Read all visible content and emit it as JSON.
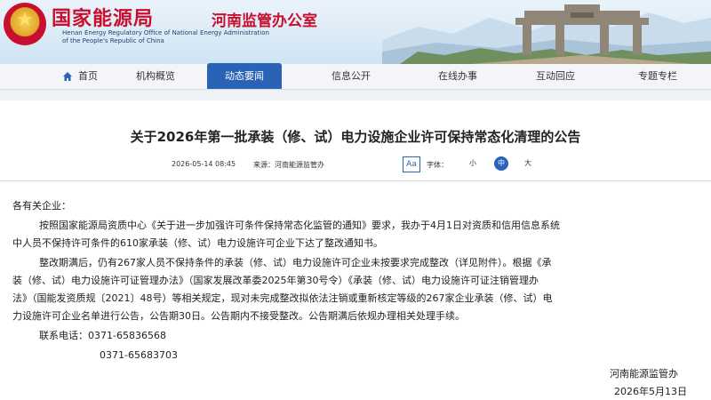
{
  "header": {
    "org_name_cn": "国家能源局",
    "office_name": "河南监管办公室",
    "org_name_en_line1": "Henan Energy Regulatory Office of National Energy Administration",
    "org_name_en_line2": "of the People's Republic of China"
  },
  "nav": {
    "items": [
      {
        "label": "首页",
        "icon": "home-icon",
        "active": false
      },
      {
        "label": "机构概览",
        "active": false
      },
      {
        "label": "动态要闻",
        "active": true
      },
      {
        "label": "信息公开",
        "active": false
      },
      {
        "label": "在线办事",
        "active": false
      },
      {
        "label": "互动回应",
        "active": false
      },
      {
        "label": "专题专栏",
        "active": false
      }
    ],
    "active_color": "#2a62b6"
  },
  "article": {
    "title": "关于2026年第一批承装（修、试）电力设施企业许可保持常态化清理的公告",
    "date": "2026-05-14 08:45",
    "source": "来源：河南能源监管办",
    "font_toggle": "Aa",
    "font_label": "字体：",
    "font_sizes": [
      "小",
      "中",
      "大"
    ],
    "font_size_selected": "中",
    "salutation": "各有关企业：",
    "paragraph1_line1": "按照国家能源局资质中心《关于进一步加强许可条件保持常态化监管的通知》要求，我办于4月1日对资质和信用信息系统",
    "paragraph1_line2": "中人员不保持许可条件的610家承装（修、试）电力设施许可企业下达了整改通知书。",
    "paragraph2_line1": "整改期满后，仍有267家人员不保持条件的承装（修、试）电力设施许可企业未按要求完成整改（详见附件）。根据《承",
    "paragraph2_line2": "装（修、试）电力设施许可证管理办法》（国家发展改革委2025年第30号令）《承装（修、试）电力设施许可证注销管理办",
    "paragraph2_line3": "法》（国能发资质规〔2021〕48号）等相关规定，现对未完成整改拟依法注销或重新核定等级的267家企业承装（修、试）电",
    "paragraph2_line4": "力设施许可企业名单进行公告，公告期30日。公告期内不接受整改。公告期满后依规办理相关处理手续。",
    "contact_label": "联系电话：",
    "phone1": "0371-65836568",
    "phone2": "0371-65683703",
    "signature": "河南能源监管办",
    "sign_date": "2026年5月13日"
  },
  "colors": {
    "brand_red": "#c8102e",
    "nav_active": "#2a62b6",
    "text": "#222222"
  }
}
